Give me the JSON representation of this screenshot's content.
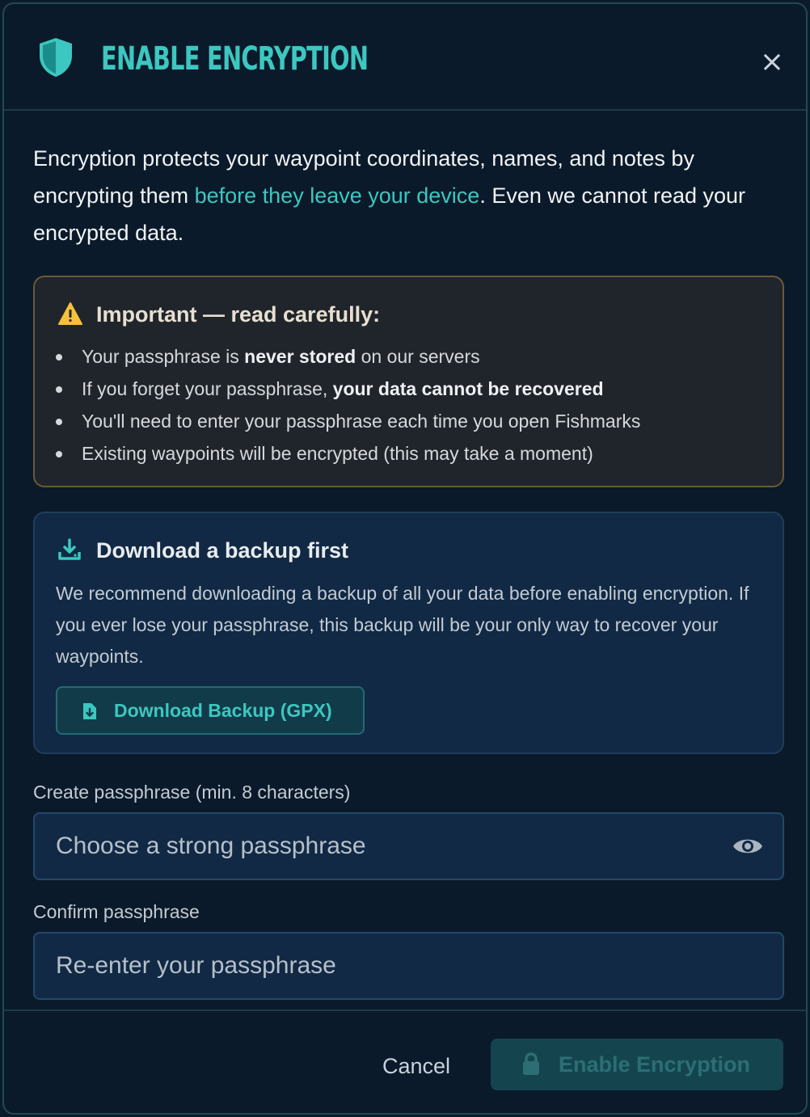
{
  "header": {
    "title": "ENABLE ENCRYPTION",
    "close_label": "×",
    "icon": "shield-icon"
  },
  "intro": {
    "text_before": "Encryption protects your waypoint coordinates, names, and notes by encrypting them ",
    "highlight": "before they leave your device",
    "text_after": ". Even we cannot read your encrypted data."
  },
  "warning": {
    "icon": "warning-icon",
    "title": "Important — read carefully:",
    "items": [
      {
        "before": "Your passphrase is ",
        "bold": "never stored",
        "after": " on our servers"
      },
      {
        "before": "If you forget your passphrase, ",
        "bold": "your data cannot be recovered",
        "after": ""
      },
      {
        "before": "You'll need to enter your passphrase each time you open Fishmarks",
        "bold": "",
        "after": ""
      },
      {
        "before": "Existing waypoints will be encrypted (this may take a moment)",
        "bold": "",
        "after": ""
      }
    ]
  },
  "backup": {
    "icon": "download-icon",
    "title": "Download a backup first",
    "description": "We recommend downloading a backup of all your data before enabling encryption. If you ever lose your passphrase, this backup will be your only way to recover your waypoints.",
    "button_label": "Download Backup (GPX)",
    "button_icon": "file-download-icon"
  },
  "form": {
    "passphrase_label": "Create passphrase (min. 8 characters)",
    "passphrase_placeholder": "Choose a strong passphrase",
    "passphrase_value": "",
    "confirm_label": "Confirm passphrase",
    "confirm_placeholder": "Re-enter your passphrase",
    "confirm_value": "",
    "eye_icon": "eye-icon"
  },
  "footer": {
    "cancel_label": "Cancel",
    "enable_label": "Enable Encryption",
    "enable_icon": "lock-icon",
    "enable_disabled": true
  },
  "colors": {
    "accent": "#3cc7c0",
    "background": "#0b1a2a",
    "warning_border": "#6b5a35",
    "warning_icon": "#f5c13a"
  }
}
